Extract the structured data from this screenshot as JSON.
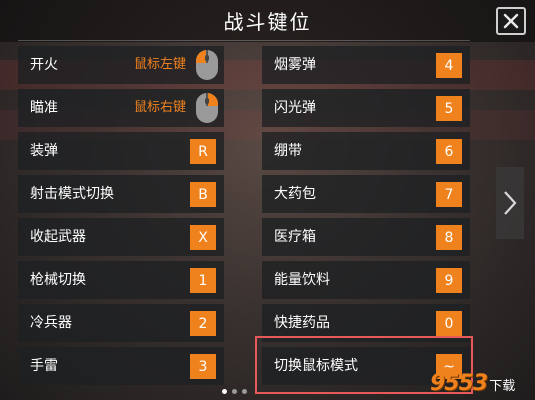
{
  "header": {
    "title": "战斗键位"
  },
  "left_items": [
    {
      "label": "开火",
      "type": "mouse",
      "value": "鼠标左键",
      "mouse_button": "left"
    },
    {
      "label": "瞄准",
      "type": "mouse",
      "value": "鼠标右键",
      "mouse_button": "right"
    },
    {
      "label": "装弹",
      "type": "key",
      "value": "R"
    },
    {
      "label": "射击模式切换",
      "type": "key",
      "value": "B"
    },
    {
      "label": "收起武器",
      "type": "key",
      "value": "X"
    },
    {
      "label": "枪械切换",
      "type": "key",
      "value": "1"
    },
    {
      "label": "冷兵器",
      "type": "key",
      "value": "2"
    },
    {
      "label": "手雷",
      "type": "key",
      "value": "3"
    }
  ],
  "right_items": [
    {
      "label": "烟雾弹",
      "type": "key",
      "value": "4"
    },
    {
      "label": "闪光弹",
      "type": "key",
      "value": "5"
    },
    {
      "label": "绷带",
      "type": "key",
      "value": "6"
    },
    {
      "label": "大药包",
      "type": "key",
      "value": "7"
    },
    {
      "label": "医疗箱",
      "type": "key",
      "value": "8"
    },
    {
      "label": "能量饮料",
      "type": "key",
      "value": "9"
    },
    {
      "label": "快捷药品",
      "type": "key",
      "value": "0"
    },
    {
      "label": "切换鼠标模式",
      "type": "key",
      "value": "~",
      "highlighted": true
    }
  ],
  "pagination": {
    "total": 3,
    "active": 0
  },
  "watermark": {
    "number": "9553",
    "text": "下载"
  },
  "colors": {
    "accent": "#f0821e",
    "highlight_border": "#e85a5a"
  }
}
